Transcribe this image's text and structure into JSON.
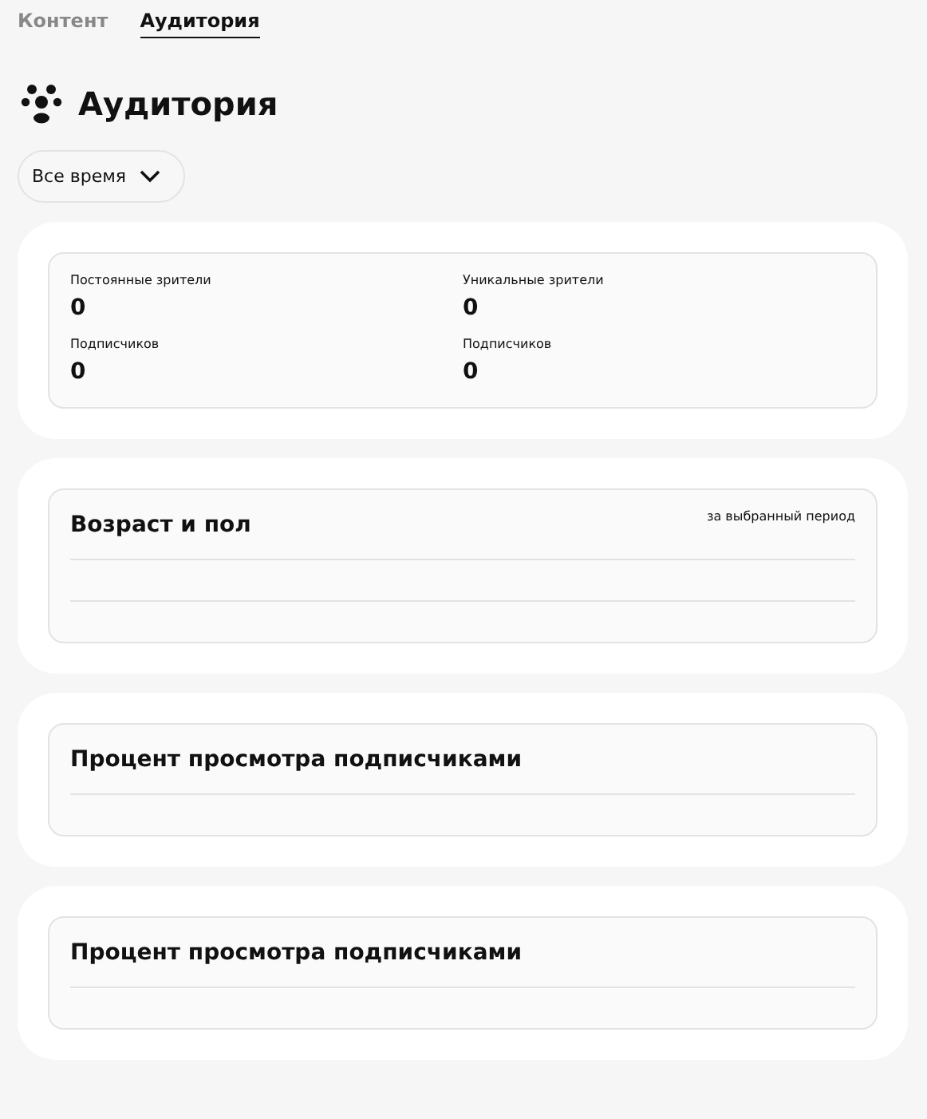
{
  "tabs": [
    {
      "label": "Контент",
      "selected": false
    },
    {
      "label": "Аудитория",
      "selected": true
    }
  ],
  "title": "Аудитория",
  "period_button": {
    "label": "Все время"
  },
  "stats": [
    {
      "label": "Постоянные зрители",
      "value": "0"
    },
    {
      "label": "Уникальные зрители",
      "value": "0"
    },
    {
      "label": "Подписчиков",
      "value": "0"
    },
    {
      "label": "Подписчиков",
      "value": "0"
    }
  ],
  "sections": [
    {
      "kind": "age",
      "title": "Возраст и пол",
      "note": "за выбранный период"
    },
    {
      "kind": "percent",
      "title": "Процент просмотра подписчиками"
    },
    {
      "kind": "percent",
      "title": "Процент просмотра подписчиками"
    }
  ]
}
